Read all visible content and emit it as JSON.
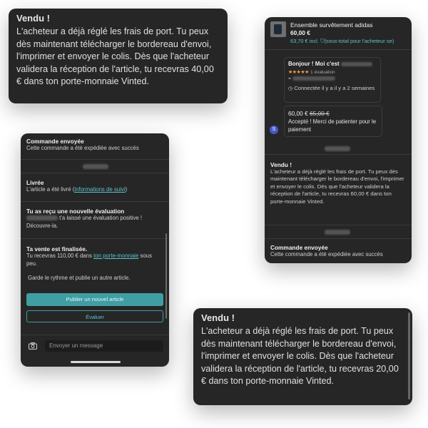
{
  "card1": {
    "title": "Vendu !",
    "body": "L'acheteur a déjà réglé les frais de port. Tu peux dès maintenant télécharger le bordereau d'envoi, l'imprimer et envoyer le colis. Dès que l'acheteur validera la réception de l'article, tu recevras 40,00 € dans ton porte-monnaie Vinted."
  },
  "card4": {
    "title": "Vendu !",
    "body": "L'acheteur a déjà réglé les frais de port. Tu peux dès maintenant télécharger le bordereau d'envoi, l'imprimer et envoyer le colis. Dès que l'acheteur validera la réception de l'article, tu recevras 20,00 € dans ton porte-monnaie Vinted."
  },
  "chat_left": {
    "sent": {
      "title": "Commande envoyée",
      "text": "Cette commande a été expédiée avec succès"
    },
    "delivered": {
      "title": "Livrée",
      "text_before": "L'article a été livré (",
      "link": "informations de suivi",
      "text_after": ")"
    },
    "review": {
      "title": "Tu as reçu une nouvelle évaluation",
      "text": "t'a laissé une évaluation positive ! Découvre-la."
    },
    "finalized": {
      "title": "Ta vente est finalisée.",
      "text_before": "Tu recevras 110,00 € dans",
      "link": "ton porte-monnaie",
      "text_after": "sous peu."
    },
    "keep_going": "Garde le rythme et publie un autre article.",
    "publish_button": "Publier un nouvel article",
    "evaluate_button": "Évaluer",
    "message_placeholder": "Envoyer un message"
  },
  "chat_right": {
    "product": {
      "name": "Ensemble survêtement adidas",
      "price": "60,00 €",
      "incl": "63,70 € incl.",
      "subtotal_note": "(sous-total pour l'acheteur·se)"
    },
    "intro": {
      "greeting": "Bonjour ! Moi c'est",
      "rating_stars": "★★★★★",
      "rating_count": "1 évaluation",
      "connected": "Connectée il y a il y a 2 semaines"
    },
    "offer": {
      "price": "60,00 €",
      "old_price": "65,00 €",
      "text": "Accepté ! Merci de patienter pour le paiement",
      "avatar_letter": "S"
    },
    "sold": {
      "title": "Vendu !",
      "body": "L'acheteur a déjà réglé les frais de port. Tu peux dès maintenant télécharger le bordereau d'envoi, l'imprimer et envoyer le colis. Dès que l'acheteur validera la réception de l'article, tu recevras 60,00 € dans ton porte-monnaie Vinted."
    },
    "sent": {
      "title": "Commande envoyée",
      "text": "Cette commande a été expédiée avec succès"
    }
  },
  "colors": {
    "accent": "#3f9ea3",
    "link": "#5fc3c7",
    "card_bg": "#262626",
    "star": "#f0a040",
    "avatar": "#4b56c8"
  }
}
